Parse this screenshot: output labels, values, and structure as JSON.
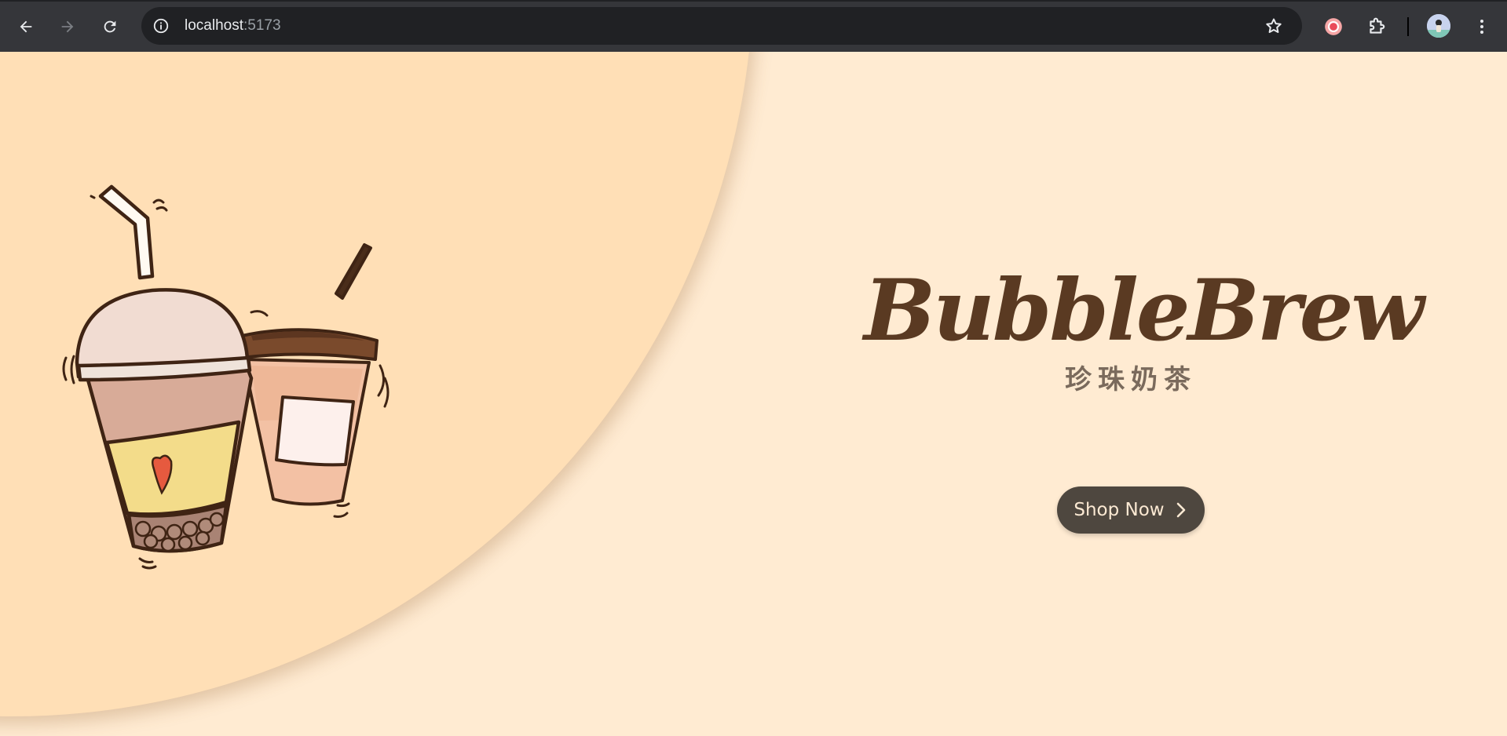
{
  "browser": {
    "url_host": "localhost",
    "url_port": ":5173",
    "icons": [
      "back-icon",
      "forward-icon",
      "reload-icon",
      "info-icon",
      "star-icon",
      "extension-record-icon",
      "extensions-puzzle-icon",
      "profile-avatar",
      "more-menu-icon"
    ]
  },
  "hero": {
    "title": "BubbleBrew",
    "subtitle": "珍珠奶茶",
    "cta_label": "Shop Now",
    "cta_icon": "chevron-right-icon",
    "illustration": "bubble-tea-cups-illustration"
  },
  "colors": {
    "page_background": "#ffebd2",
    "hero_circle": "#ffdfb6",
    "title": "#5a3a22",
    "subtitle": "#7a6a5c",
    "button_background": "#4e473f",
    "button_text": "#fbe9d3"
  }
}
